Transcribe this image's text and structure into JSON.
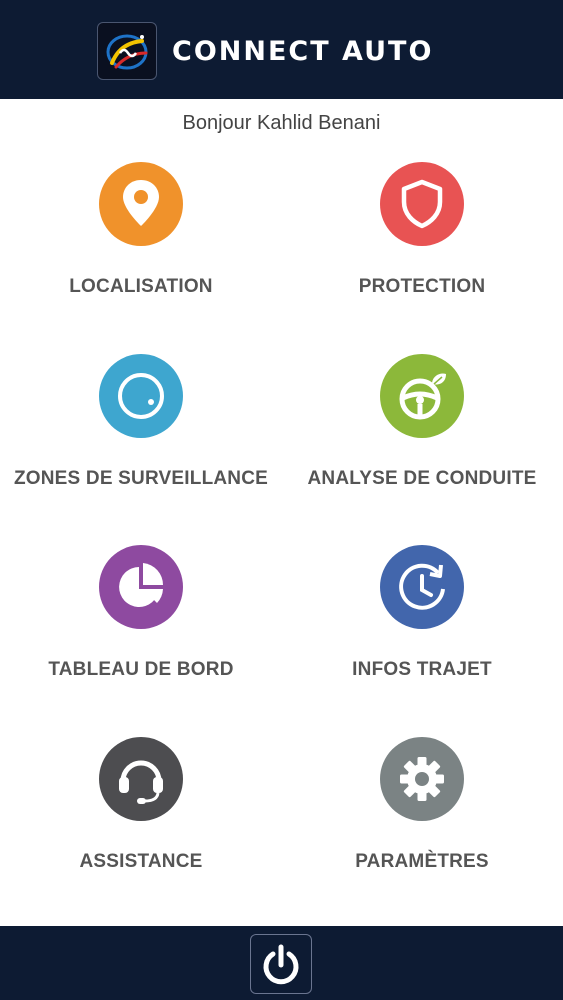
{
  "header": {
    "logo_icon": "connect-auto-logo",
    "title": "CONNECT AUTO",
    "background": "#0d1b33"
  },
  "greeting": "Bonjour Kahlid Benani",
  "tiles": [
    {
      "label": "LOCALISATION",
      "icon": "location-pin-icon",
      "color": "#f0922b"
    },
    {
      "label": "PROTECTION",
      "icon": "shield-icon",
      "color": "#e85353"
    },
    {
      "label": "ZONES DE SURVEILLANCE",
      "icon": "zone-circle-icon",
      "color": "#3ea6cf"
    },
    {
      "label": "ANALYSE DE CONDUITE",
      "icon": "steering-wheel-eco-icon",
      "color": "#8cb83a"
    },
    {
      "label": "TABLEAU DE BORD",
      "icon": "pie-chart-icon",
      "color": "#8e4aa0"
    },
    {
      "label": "INFOS TRAJET",
      "icon": "clock-history-icon",
      "color": "#4266ac"
    },
    {
      "label": "ASSISTANCE",
      "icon": "headset-icon",
      "color": "#4d4d50"
    },
    {
      "label": "PARAMÈTRES",
      "icon": "gear-icon",
      "color": "#7b8384"
    }
  ],
  "footer": {
    "power_icon": "power-icon"
  }
}
